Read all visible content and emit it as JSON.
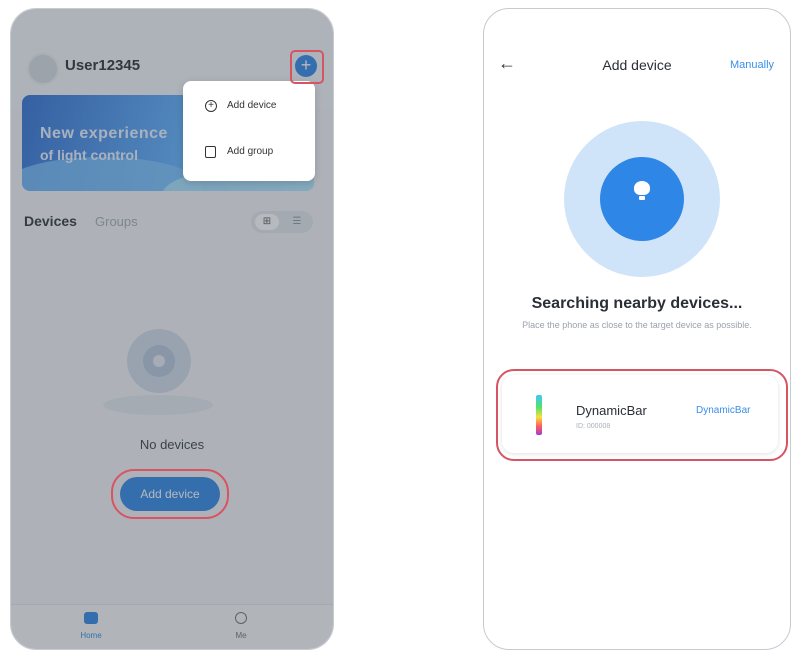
{
  "left_screen": {
    "username": "User12345",
    "add_button_glyph": "+",
    "banner": {
      "line1": "New experience",
      "line2": "of light control"
    },
    "tabs": {
      "devices": "Devices",
      "groups": "Groups"
    },
    "view_toggle": {
      "grid_icon": "⊞",
      "list_icon": "☰"
    },
    "empty_state": {
      "text": "No devices",
      "button_label": "Add device"
    },
    "bottom_nav": {
      "home": "Home",
      "me": "Me"
    },
    "popup_menu": {
      "items": [
        {
          "label": "Add device",
          "icon": "add-circle-icon"
        },
        {
          "label": "Add group",
          "icon": "group-icon"
        }
      ]
    },
    "colors": {
      "accent": "#2e86e6",
      "highlight": "#d65563"
    }
  },
  "right_screen": {
    "title": "Add device",
    "manually": "Manually",
    "back_glyph": "←",
    "searching": {
      "title": "Searching nearby devices...",
      "subtitle": "Place the phone as close to the target device as possible."
    },
    "device": {
      "name": "DynamicBar",
      "id": "ID: 000008",
      "action": "DynamicBar"
    }
  }
}
